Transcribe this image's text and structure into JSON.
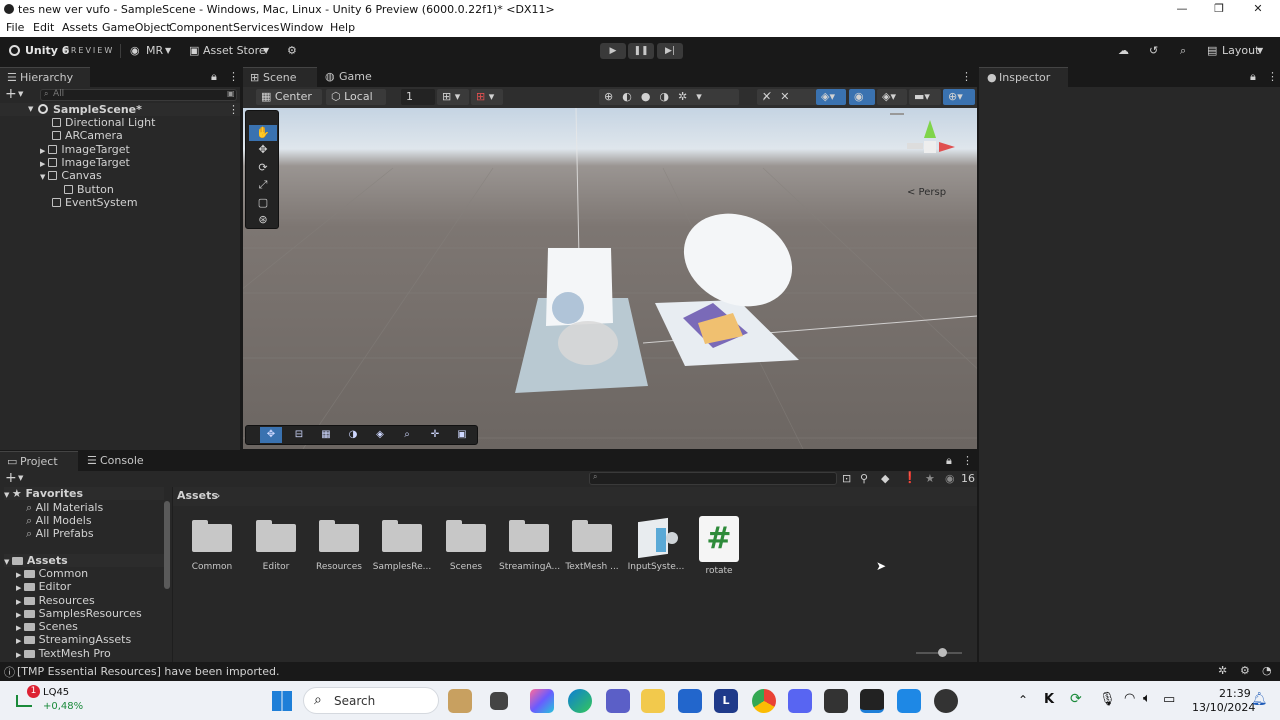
{
  "window": {
    "title": "tes new ver vufo - SampleScene - Windows, Mac, Linux - Unity 6 Preview (6000.0.22f1)* <DX11>",
    "min": "—",
    "max": "❐",
    "close": "✕"
  },
  "menu": [
    "File",
    "Edit",
    "Assets",
    "GameObject",
    "Component",
    "Services",
    "Window",
    "Help"
  ],
  "toolbar": {
    "brand": "Unity 6",
    "brand_badge": "PREVIEW",
    "account": "MR",
    "asset_store": "Asset Store",
    "layout": "Layout"
  },
  "hierarchy": {
    "tab": "Hierarchy",
    "search_placeholder": "All",
    "scene": "SampleScene*",
    "items": [
      {
        "label": "Directional Light"
      },
      {
        "label": "ARCamera"
      },
      {
        "label": "ImageTarget"
      },
      {
        "label": "ImageTarget"
      },
      {
        "label": "Canvas"
      },
      {
        "label": "Button"
      },
      {
        "label": "EventSystem"
      }
    ]
  },
  "scene": {
    "tabs": [
      "Scene",
      "Game"
    ],
    "pivot": "Center",
    "space": "Local",
    "grid_value": "1",
    "persp": "< Persp"
  },
  "inspector": {
    "tab": "Inspector"
  },
  "project": {
    "tabs": [
      "Project",
      "Console"
    ],
    "favorites_label": "Favorites",
    "favorites": [
      "All Materials",
      "All Models",
      "All Prefabs"
    ],
    "assets_label": "Assets",
    "folders": [
      "Common",
      "Editor",
      "Resources",
      "SamplesResources",
      "Scenes",
      "StreamingAssets",
      "TextMesh Pro"
    ],
    "breadcrumb": "Assets",
    "hidden_count": "16",
    "tiles": [
      "Common",
      "Editor",
      "Resources",
      "SamplesRe...",
      "Scenes",
      "StreamingA...",
      "TextMesh ...",
      "InputSyste...",
      "rotate"
    ]
  },
  "status": {
    "message": "[TMP Essential Resources] have been imported."
  },
  "taskbar": {
    "stock_name": "LQ45",
    "stock_change": "+0,48%",
    "stock_badge": "1",
    "search": "Search",
    "time": "21:39",
    "date": "13/10/2024"
  },
  "colors": {
    "accent": "#3a72b0",
    "stock_up": "#1a8a3a",
    "editor_bg": "#191919",
    "panel_bg": "#282828"
  }
}
